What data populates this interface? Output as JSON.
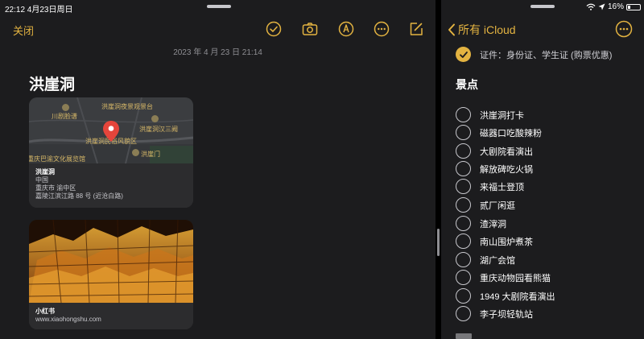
{
  "status": {
    "time_date": "22:12  4月23日周日",
    "battery": "16%"
  },
  "left": {
    "close_label": "关闭",
    "toolbar": {
      "icons": [
        "checklist-icon",
        "camera-icon",
        "markup-icon",
        "more-icon",
        "compose-icon"
      ]
    },
    "date": "2023 年 4 月 23 日 21:14",
    "title": "洪崖洞",
    "map_card": {
      "map_labels": [
        "川剧脸谱",
        "洪崖洞夜景观景台",
        "洪崖洞民俗风貌区",
        "洪崖洞汉三阙",
        "洪崖门",
        "重庆巴渝文化展览馆"
      ],
      "name": "洪崖洞",
      "country": "中国",
      "city": "重庆市 渝中区",
      "address": "嘉陵江滨江路 88 号 (近沧白路)"
    },
    "link_card": {
      "site_name": "小红书",
      "url": "www.xiaohongshu.com"
    }
  },
  "right": {
    "back_label": "所有 iCloud",
    "first_item": "证件：身份证、学生证 (购票优惠)",
    "section": "景点",
    "items": [
      "洪崖洞打卡",
      "磁器口吃酸辣粉",
      "大剧院看演出",
      "解放碑吃火锅",
      "来福士登顶",
      "贰厂闲逛",
      "渣滓洞",
      "南山围炉煮茶",
      "湖广会馆",
      "重庆动物园看熊猫",
      "1949 大剧院看演出",
      "李子坝轻轨站"
    ]
  },
  "colors": {
    "accent": "#e3b341",
    "background": "#1c1c1e",
    "card": "#2c2c2e",
    "secondary_text": "#8e8e93"
  }
}
